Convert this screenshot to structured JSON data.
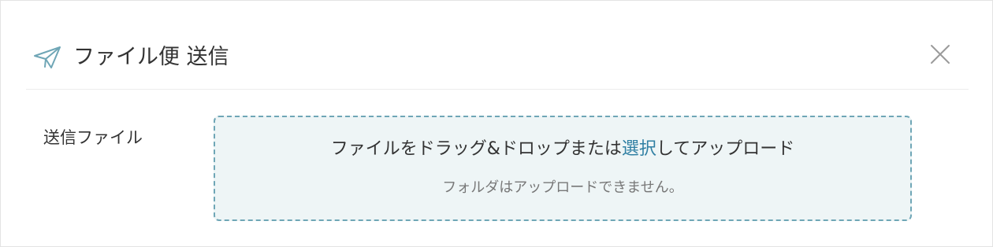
{
  "modal": {
    "title": "ファイル便 送信",
    "icon": "paper-plane-icon",
    "close_icon": "close-icon"
  },
  "form": {
    "file_label": "送信ファイル",
    "dropzone": {
      "text_before": "ファイルをドラッグ&ドロップまたは",
      "link": "選択",
      "text_after": "してアップロード",
      "note": "フォルダはアップロードできません。"
    }
  },
  "colors": {
    "accent": "#2f7fa3",
    "dropzone_bg": "#eef5f6",
    "dropzone_border": "#6fa6b6",
    "icon": "#6fa6b6",
    "text": "#333333",
    "muted_text": "#777777"
  }
}
